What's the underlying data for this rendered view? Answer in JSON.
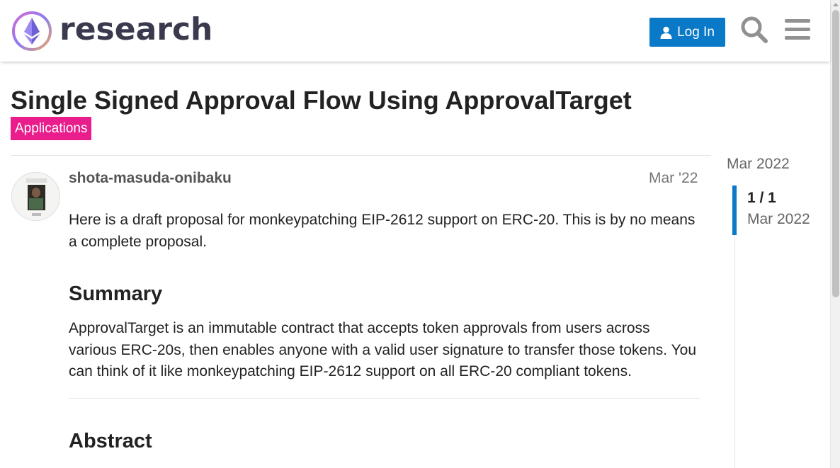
{
  "header": {
    "logo_text": "research",
    "login_label": "Log In",
    "icons": {
      "search": "search-icon",
      "menu": "hamburger-menu-icon",
      "login": "user-icon"
    }
  },
  "topic": {
    "title": "Single Signed Approval Flow Using ApprovalTarget",
    "category": "Applications",
    "category_color": "#e91e8c"
  },
  "post": {
    "username": "shota-masuda-onibaku",
    "date": "Mar '22",
    "intro": "Here is a draft proposal for monkeypatching EIP-2612 support on ERC-20. This is by no means a complete proposal.",
    "summary_heading": "Summary",
    "summary_text": "ApprovalTarget is an immutable contract that accepts token approvals from users across various ERC-20s, then enables anyone with a valid user signature to transfer those tokens. You can think of it like monkeypatching EIP-2612 support on all ERC-20 compliant tokens.",
    "abstract_heading": "Abstract"
  },
  "timeline": {
    "start_date": "Mar 2022",
    "position": "1 / 1",
    "current_date": "Mar 2022"
  },
  "colors": {
    "accent": "#0a79c7",
    "category": "#e91e8c"
  }
}
